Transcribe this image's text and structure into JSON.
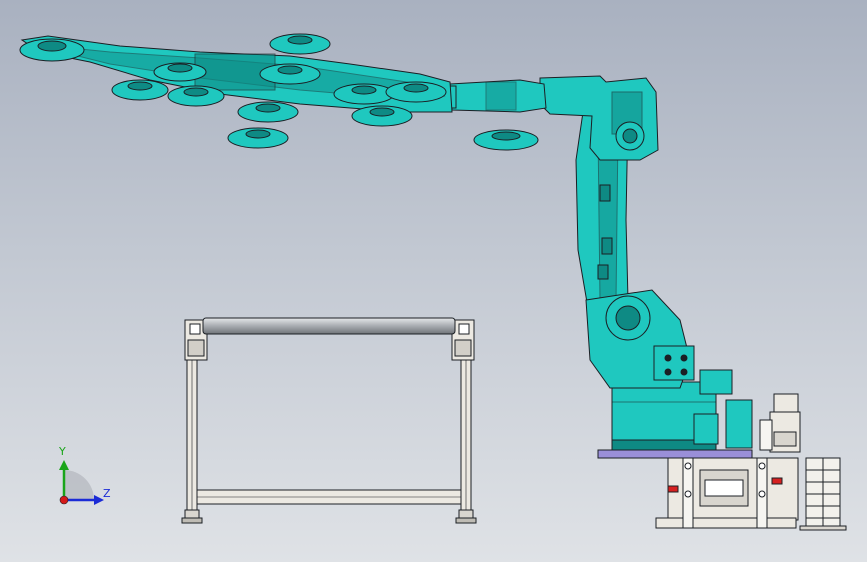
{
  "viewport": {
    "background_top": "#a9b1c0",
    "background_bottom": "#dfe2e6"
  },
  "colors": {
    "robot": "#1fc8bf",
    "robot_dark": "#0e8a84",
    "outline": "#1b1f24",
    "frame_fill": "#ece9e2",
    "roller": "#b9bcc0",
    "plate": "#9a8fd8",
    "axis_y": "#1aa51a",
    "axis_z": "#1b2bd6",
    "axis_x": "#d41919"
  },
  "triad": {
    "y_label": "Y",
    "z_label": "Z"
  }
}
